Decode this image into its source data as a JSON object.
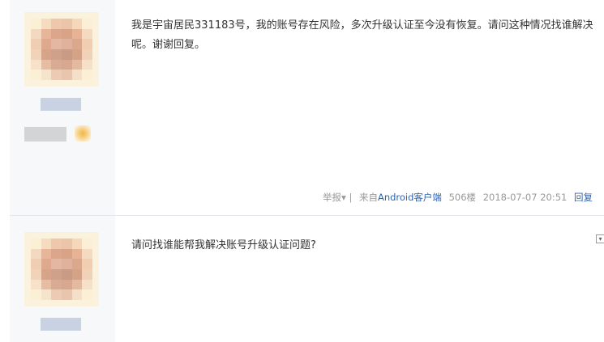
{
  "posts": [
    {
      "text": "我是宇宙居民331183号，我的账号存在风险，多次升级认证至今没有恢复。请问这种情况找谁解决呢。谢谢回复。",
      "footer": {
        "report": "举报",
        "report_arrow": "▾",
        "separator": "|",
        "source_prefix": "来自",
        "source_link": "Android客户端",
        "floor": "506楼",
        "datetime": "2018-07-07 20:51",
        "reply": "回复"
      }
    },
    {
      "text": "请问找谁能帮我解决账号升级认证问题?"
    }
  ],
  "menu_toggle_glyph": "▾",
  "colors": {
    "link": "#2d64b3",
    "meta": "#999999",
    "text": "#333333",
    "sidebar": "#f7f8fa"
  }
}
